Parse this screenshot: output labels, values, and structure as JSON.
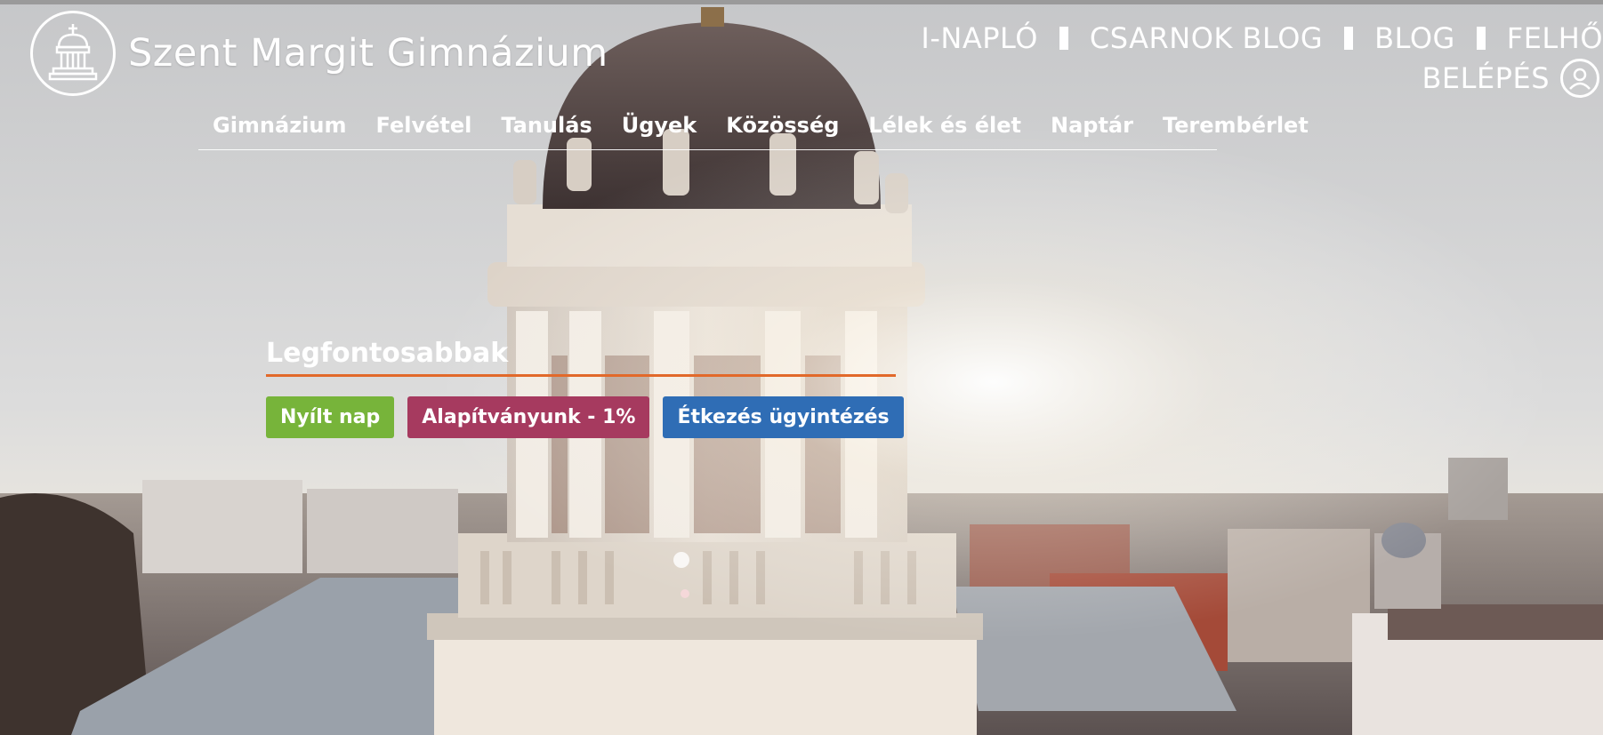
{
  "site": {
    "title": "Szent Margit Gimnázium",
    "logo_icon": "church-dome-icon"
  },
  "top_links": [
    {
      "label": "I-NAPLÓ"
    },
    {
      "label": "CSARNOK BLOG"
    },
    {
      "label": "BLOG"
    },
    {
      "label": "FELHŐ"
    }
  ],
  "login": {
    "label": "BELÉPÉS",
    "icon": "user-icon"
  },
  "main_nav": [
    {
      "label": "Gimnázium"
    },
    {
      "label": "Felvétel"
    },
    {
      "label": "Tanulás"
    },
    {
      "label": "Ügyek"
    },
    {
      "label": "Közösség"
    },
    {
      "label": "Lélek és élet"
    },
    {
      "label": "Naptár"
    },
    {
      "label": "Terembérlet"
    }
  ],
  "highlights": {
    "heading": "Legfontosabbak",
    "buttons": [
      {
        "label": "Nyílt nap",
        "color": "#77b43a"
      },
      {
        "label": "Alapítványunk - 1%",
        "color": "#a63a5f"
      },
      {
        "label": "Étkezés ügyintézés",
        "color": "#2f6db5"
      }
    ]
  },
  "colors": {
    "accent_underline": "#e2692a",
    "nav_text": "#ffffff"
  }
}
